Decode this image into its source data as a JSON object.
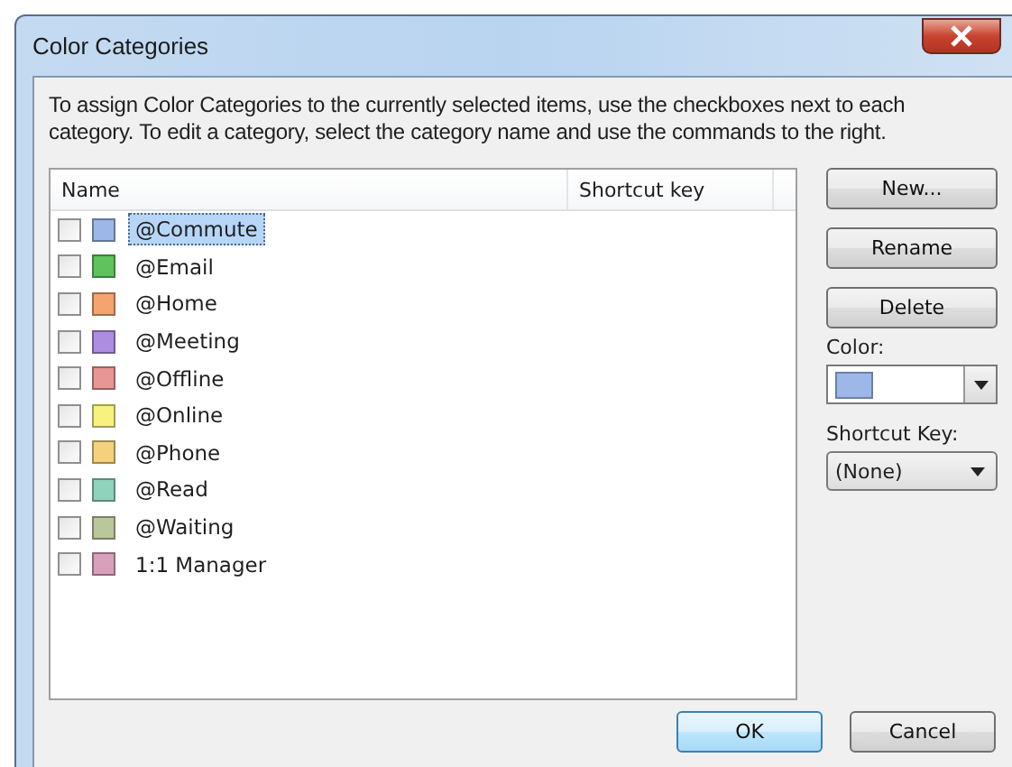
{
  "window": {
    "title": "Color Categories"
  },
  "instructions": "To assign Color Categories to the currently selected items, use the checkboxes next to each category.  To edit a category, select the category name and use the commands to the right.",
  "list": {
    "columns": [
      "Name",
      "Shortcut key"
    ],
    "items": [
      {
        "name": "@Commute",
        "color": "#9db7e8",
        "checked": false,
        "selected": true
      },
      {
        "name": "@Email",
        "color": "#5fc25c",
        "checked": false,
        "selected": false
      },
      {
        "name": "@Home",
        "color": "#f5a36f",
        "checked": false,
        "selected": false
      },
      {
        "name": "@Meeting",
        "color": "#ad8de0",
        "checked": false,
        "selected": false
      },
      {
        "name": "@Offline",
        "color": "#e79595",
        "checked": false,
        "selected": false
      },
      {
        "name": "@Online",
        "color": "#f7f27f",
        "checked": false,
        "selected": false
      },
      {
        "name": "@Phone",
        "color": "#f5d17d",
        "checked": false,
        "selected": false
      },
      {
        "name": "@Read",
        "color": "#8fd3bd",
        "checked": false,
        "selected": false
      },
      {
        "name": "@Waiting",
        "color": "#b9c79b",
        "checked": false,
        "selected": false
      },
      {
        "name": "1:1 Manager",
        "color": "#d9a0bb",
        "checked": false,
        "selected": false
      }
    ]
  },
  "side_buttons": [
    "New...",
    "Rename",
    "Delete"
  ],
  "color_label": "Color:",
  "shortcut_label": "Shortcut Key:",
  "shortcut_value": "(None)",
  "buttons": [
    {
      "label": "OK",
      "default": true
    },
    {
      "label": "Cancel",
      "default": false
    }
  ]
}
